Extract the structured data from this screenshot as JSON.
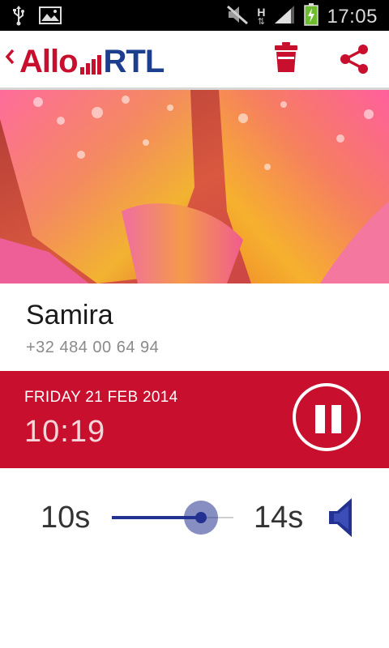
{
  "status_bar": {
    "time": "17:05",
    "network_label": "H",
    "icons": [
      "usb-icon",
      "image-icon",
      "mute-icon",
      "network-h-icon",
      "signal-icon",
      "battery-charging-icon"
    ]
  },
  "app_bar": {
    "logo_part1": "Allo",
    "logo_part2": "RTL",
    "icons": [
      "back-chevron-icon",
      "trash-icon",
      "share-icon"
    ]
  },
  "contact": {
    "name": "Samira",
    "phone": "+32 484 00 64 94"
  },
  "call": {
    "date": "FRIDAY 21 FEB 2014",
    "time": "10:19",
    "control": "pause-icon"
  },
  "playback": {
    "elapsed": "10s",
    "remaining": "14s",
    "progress_fraction": 0.73
  },
  "colors": {
    "brand_red": "#c8102e",
    "brand_blue": "#1d3d8f",
    "slider_blue": "#233190"
  }
}
